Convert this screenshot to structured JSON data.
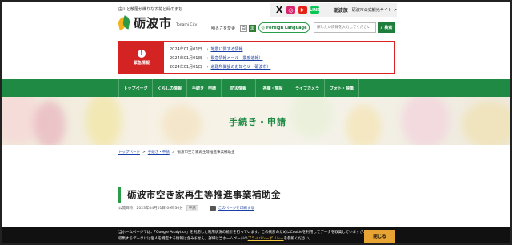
{
  "header": {
    "tagline": "庄川と散居が織りなす花と緑のまち",
    "logo_name": "砺波市",
    "logo_en": "Tonami City",
    "social": {
      "x_icon": "X",
      "instagram_icon": "◎",
      "youtube_icon": "▶",
      "line_icon": "LINE"
    },
    "tourism_logo": "砺波旅",
    "tourism_label": "砺波市公式観光サイト",
    "brightness_label": "明るさを変更",
    "brightness_light": "白",
    "brightness_dark": "黒",
    "foreign_language": "Foreign Language",
    "search_placeholder": "探したい情報を入力してください",
    "search_button": "検索"
  },
  "emergency": {
    "label": "緊急情報",
    "items": [
      {
        "date": "2024年01月01日",
        "title": "地震に関する情報"
      },
      {
        "date": "2024年01月01日",
        "title": "緊急情報メール（震度速報）"
      },
      {
        "date": "2024年01月01日",
        "title": "避難所開設のお知らせ（砺波市）"
      }
    ]
  },
  "nav": [
    "トップページ",
    "くらしの情報",
    "手続き・申請",
    "防災情報",
    "各課・施設",
    "ライブカメラ",
    "フォト・映像"
  ],
  "hero": {
    "title": "手続き・申請"
  },
  "breadcrumb": {
    "home": "トップページ",
    "section": "手続き・申請",
    "current": "砺波市空き家再生等推進事業補助金"
  },
  "page": {
    "title": "砺波市空き家再生等推進事業補助金",
    "published": "公開日時：2023年04月01日 09時30分",
    "badge": "申請",
    "print_label": "このページを印刷する"
  },
  "cookie": {
    "line1": "当ホームページでは、「Google Analytics」を利用した利用状況の統計を行っています。この統計のためにCookieを利用してデータを収集していますが、",
    "line2a": "収集するデータには個人を特定する情報は含みません。詳細は当ホームページの",
    "privacy_link": "プライバシーポリシー",
    "line2b": "を参照ください。",
    "close_button": "閉じる"
  },
  "colors": {
    "primary_green": "#1f8a43",
    "alert_red": "#d42323",
    "cookie_button": "#e8a432"
  }
}
